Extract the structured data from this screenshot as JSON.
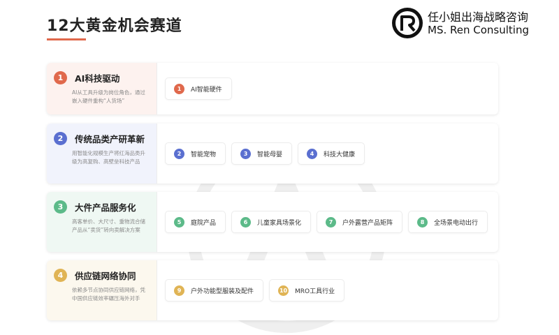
{
  "header": {
    "title": "12大黄金机会赛道",
    "brand_cn": "任小姐出海战略咨询",
    "brand_en": "MS. Ren Consulting",
    "accent_color": "#e0694c"
  },
  "categories": [
    {
      "num": "1",
      "title": "AI科技驱动",
      "desc": "AI从工具升级为岗位角色，通过嵌入硬件重构“人货场”",
      "color": "#e0694c",
      "bg": "#fdf2ef",
      "items": [
        {
          "num": "1",
          "label": "AI智能硬件"
        }
      ]
    },
    {
      "num": "2",
      "title": "传统品类产研革新",
      "desc": "用智能化规模生产将红海品类升级为高复购、高壁垒科技产品",
      "color": "#5a6fd0",
      "bg": "#f1f3fc",
      "items": [
        {
          "num": "2",
          "label": "智能宠物"
        },
        {
          "num": "3",
          "label": "智能母婴"
        },
        {
          "num": "4",
          "label": "科技大健康"
        }
      ]
    },
    {
      "num": "3",
      "title": "大件产品服务化",
      "desc": "高客单价、大尺寸、重物流合储产品从“卖货”转向卖解决方案",
      "color": "#5cba89",
      "bg": "#eff8f3",
      "items": [
        {
          "num": "5",
          "label": "庭院产品"
        },
        {
          "num": "6",
          "label": "儿童家具场景化"
        },
        {
          "num": "7",
          "label": "户外露营产品矩阵"
        },
        {
          "num": "8",
          "label": "全场景电动出行"
        }
      ]
    },
    {
      "num": "4",
      "title": "供应链网络协同",
      "desc": "依赖多节点协同供应链网络，凭中国供应链效率碾压海外对手",
      "color": "#e0b455",
      "bg": "#fcf8ee",
      "items": [
        {
          "num": "9",
          "label": "户外功能型服装及配件"
        },
        {
          "num": "10",
          "label": "MRO工具行业"
        }
      ]
    }
  ]
}
